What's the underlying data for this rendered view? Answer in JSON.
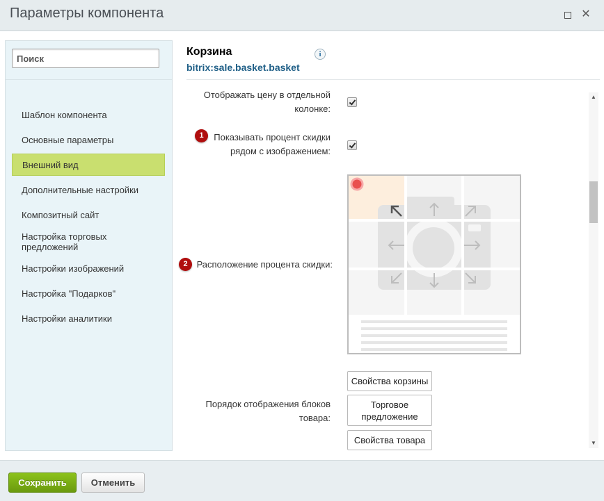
{
  "window": {
    "title": "Параметры компонента",
    "maximize_icon": "maximize-icon",
    "close_icon": "close-icon",
    "close_glyph": "✕"
  },
  "sidebar": {
    "search_placeholder": "Поиск",
    "items": [
      {
        "label": "Шаблон компонента",
        "active": false
      },
      {
        "label": "Основные параметры",
        "active": false
      },
      {
        "label": "Внешний вид",
        "active": true
      },
      {
        "label": "Дополнительные настройки",
        "active": false
      },
      {
        "label": "Композитный сайт",
        "active": false
      },
      {
        "label": "Настройка торговых предложений",
        "active": false
      },
      {
        "label": "Настройки изображений",
        "active": false
      },
      {
        "label": "Настройка \"Подарков\"",
        "active": false
      },
      {
        "label": "Настройки аналитики",
        "active": false
      }
    ],
    "active_color": "#c9df6f"
  },
  "header": {
    "title": "Корзина",
    "subtitle": "bitrix:sale.basket.basket",
    "info_glyph": "i",
    "subtitle_color": "#1f5f87"
  },
  "params": {
    "price_column": {
      "label_line1": "Отображать цену в отдельной",
      "label_line2": "колонке:",
      "checked": true
    },
    "discount_percent": {
      "badge": "1",
      "label_line1": "Показывать процент скидки",
      "label_line2": "рядом с изображением:",
      "checked": true
    },
    "discount_position": {
      "badge": "2",
      "label": "Расположение процента скидки:",
      "selected": "top-left"
    },
    "blocks_order": {
      "label_line1": "Порядок отображения блоков",
      "label_line2": "товара:",
      "buttons": [
        "Свойства корзины",
        "Торговое предложение",
        "Свойства товара"
      ]
    }
  },
  "scrollbar": {
    "up_glyph": "▲",
    "down_glyph": "▼"
  },
  "footer": {
    "save_label": "Сохранить",
    "cancel_label": "Отменить",
    "save_color": "#7ab317"
  },
  "colors": {
    "badge": "#b00d0d",
    "highlight_cell": "#fdeedd"
  }
}
